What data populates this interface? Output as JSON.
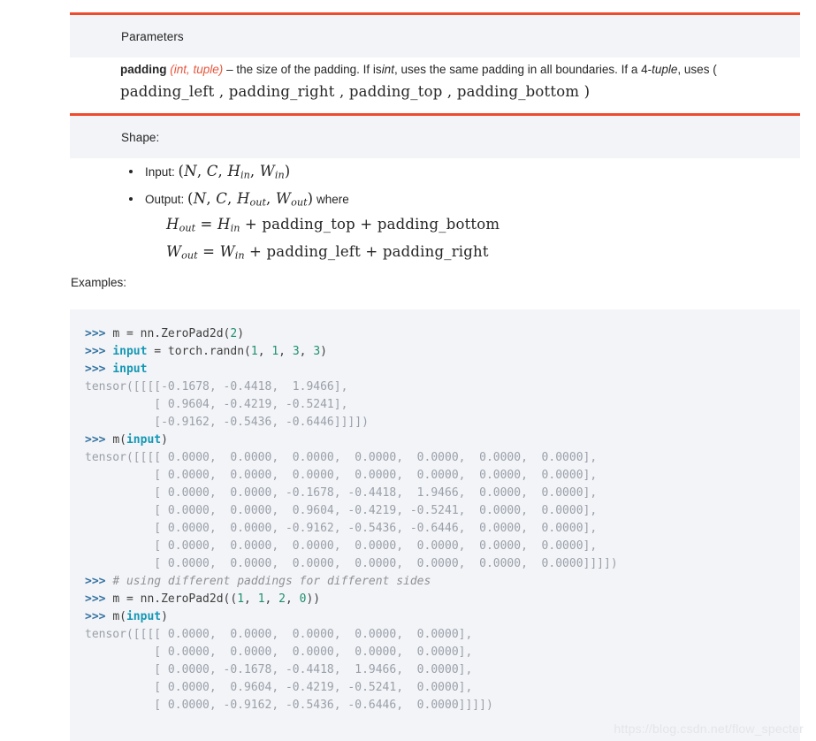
{
  "sections": {
    "parameters": {
      "title": "Parameters",
      "param_name": "padding",
      "param_types": "(int, tuple)",
      "desc_part1": "– the size of the padding. If is",
      "desc_em1": "int",
      "desc_part2": ", uses the same padding in all boundaries. If a 4-",
      "desc_em2": "tuple",
      "desc_part3": ", uses (",
      "formula_inline": "padding_left , padding_right , padding_top , padding_bottom )"
    },
    "shape": {
      "title": "Shape:",
      "items": [
        {
          "label": "Input:",
          "formula": "(N, C, H_in, W_in)"
        },
        {
          "label": "Output:",
          "formula": "(N, C, H_out, W_out)",
          "suffix": "where"
        }
      ],
      "formulas": [
        "H_out = H_in + padding_top + padding_bottom",
        "W_out = W_in + padding_left + padding_right"
      ]
    },
    "examples": {
      "label": "Examples:"
    }
  },
  "code": {
    "lines": [
      [
        {
          "t": ">>> ",
          "c": "prompt"
        },
        {
          "t": "m = nn.ZeroPad2d(",
          "c": "plain"
        },
        {
          "t": "2",
          "c": "num"
        },
        {
          "t": ")",
          "c": "plain"
        }
      ],
      [
        {
          "t": ">>> ",
          "c": "prompt"
        },
        {
          "t": "input",
          "c": "kw"
        },
        {
          "t": " = torch.randn(",
          "c": "plain"
        },
        {
          "t": "1",
          "c": "num"
        },
        {
          "t": ", ",
          "c": "plain"
        },
        {
          "t": "1",
          "c": "num"
        },
        {
          "t": ", ",
          "c": "plain"
        },
        {
          "t": "3",
          "c": "num"
        },
        {
          "t": ", ",
          "c": "plain"
        },
        {
          "t": "3",
          "c": "num"
        },
        {
          "t": ")",
          "c": "plain"
        }
      ],
      [
        {
          "t": ">>> ",
          "c": "prompt"
        },
        {
          "t": "input",
          "c": "kw"
        }
      ],
      [
        {
          "t": "tensor([[[[-0.1678, -0.4418,  1.9466],",
          "c": "out"
        }
      ],
      [
        {
          "t": "          [ 0.9604, -0.4219, -0.5241],",
          "c": "out"
        }
      ],
      [
        {
          "t": "          [-0.9162, -0.5436, -0.6446]]]])",
          "c": "out"
        }
      ],
      [
        {
          "t": ">>> ",
          "c": "prompt"
        },
        {
          "t": "m(",
          "c": "plain"
        },
        {
          "t": "input",
          "c": "kw"
        },
        {
          "t": ")",
          "c": "plain"
        }
      ],
      [
        {
          "t": "tensor([[[[ 0.0000,  0.0000,  0.0000,  0.0000,  0.0000,  0.0000,  0.0000],",
          "c": "out"
        }
      ],
      [
        {
          "t": "          [ 0.0000,  0.0000,  0.0000,  0.0000,  0.0000,  0.0000,  0.0000],",
          "c": "out"
        }
      ],
      [
        {
          "t": "          [ 0.0000,  0.0000, -0.1678, -0.4418,  1.9466,  0.0000,  0.0000],",
          "c": "out"
        }
      ],
      [
        {
          "t": "          [ 0.0000,  0.0000,  0.9604, -0.4219, -0.5241,  0.0000,  0.0000],",
          "c": "out"
        }
      ],
      [
        {
          "t": "          [ 0.0000,  0.0000, -0.9162, -0.5436, -0.6446,  0.0000,  0.0000],",
          "c": "out"
        }
      ],
      [
        {
          "t": "          [ 0.0000,  0.0000,  0.0000,  0.0000,  0.0000,  0.0000,  0.0000],",
          "c": "out"
        }
      ],
      [
        {
          "t": "          [ 0.0000,  0.0000,  0.0000,  0.0000,  0.0000,  0.0000,  0.0000]]]])",
          "c": "out"
        }
      ],
      [
        {
          "t": ">>> ",
          "c": "prompt"
        },
        {
          "t": "# using different paddings for different sides",
          "c": "comment"
        }
      ],
      [
        {
          "t": ">>> ",
          "c": "prompt"
        },
        {
          "t": "m = nn.ZeroPad2d((",
          "c": "plain"
        },
        {
          "t": "1",
          "c": "num"
        },
        {
          "t": ", ",
          "c": "plain"
        },
        {
          "t": "1",
          "c": "num"
        },
        {
          "t": ", ",
          "c": "plain"
        },
        {
          "t": "2",
          "c": "num"
        },
        {
          "t": ", ",
          "c": "plain"
        },
        {
          "t": "0",
          "c": "num"
        },
        {
          "t": "))",
          "c": "plain"
        }
      ],
      [
        {
          "t": ">>> ",
          "c": "prompt"
        },
        {
          "t": "m(",
          "c": "plain"
        },
        {
          "t": "input",
          "c": "kw"
        },
        {
          "t": ")",
          "c": "plain"
        }
      ],
      [
        {
          "t": "tensor([[[[ 0.0000,  0.0000,  0.0000,  0.0000,  0.0000],",
          "c": "out"
        }
      ],
      [
        {
          "t": "          [ 0.0000,  0.0000,  0.0000,  0.0000,  0.0000],",
          "c": "out"
        }
      ],
      [
        {
          "t": "          [ 0.0000, -0.1678, -0.4418,  1.9466,  0.0000],",
          "c": "out"
        }
      ],
      [
        {
          "t": "          [ 0.0000,  0.9604, -0.4219, -0.5241,  0.0000],",
          "c": "out"
        }
      ],
      [
        {
          "t": "          [ 0.0000, -0.9162, -0.5436, -0.6446,  0.0000]]]])",
          "c": "out"
        }
      ]
    ]
  },
  "watermark": "https://blog.csdn.net/flow_specter",
  "colors": {
    "accent_border": "#ee4c2c",
    "section_bg": "#f3f4f7",
    "type_hint": "#e8553c",
    "prompt": "#3372a1",
    "keyword": "#1497b5",
    "number": "#1e8f6e",
    "output": "#9aa0aa"
  }
}
